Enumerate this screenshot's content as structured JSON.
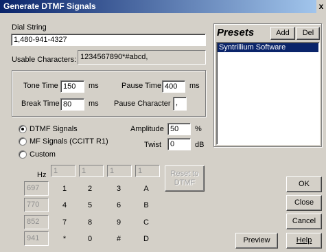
{
  "window": {
    "title": "Generate DTMF Signals",
    "close_glyph": "x"
  },
  "dial": {
    "label": "Dial String",
    "value": "1,480-941-4327",
    "usable_label": "Usable Characters:",
    "usable_value": "1234567890*#abcd,"
  },
  "timing": {
    "tone_time_label": "Tone Time",
    "tone_time_value": "150",
    "tone_time_unit": "ms",
    "break_time_label": "Break Time",
    "break_time_value": "80",
    "break_time_unit": "ms",
    "pause_time_label": "Pause Time",
    "pause_time_value": "400",
    "pause_time_unit": "ms",
    "pause_char_label": "Pause Character",
    "pause_char_value": ","
  },
  "signal_type": {
    "options": [
      {
        "label": "DTMF Signals",
        "selected": true
      },
      {
        "label": "MF Signals (CCITT R1)",
        "selected": false
      },
      {
        "label": "Custom",
        "selected": false
      }
    ],
    "amplitude_label": "Amplitude",
    "amplitude_value": "50",
    "amplitude_unit": "%",
    "twist_label": "Twist",
    "twist_value": "0",
    "twist_unit": "dB"
  },
  "keypad": {
    "hz_label": "Hz",
    "col_freqs": [
      "1",
      "1",
      "1",
      "1"
    ],
    "row_freqs": [
      "697",
      "770",
      "852",
      "941"
    ],
    "keys": [
      [
        "1",
        "2",
        "3",
        "A"
      ],
      [
        "4",
        "5",
        "6",
        "B"
      ],
      [
        "7",
        "8",
        "9",
        "C"
      ],
      [
        "*",
        "0",
        "#",
        "D"
      ]
    ],
    "reset_label_1": "Reset to",
    "reset_label_2": "DTMF"
  },
  "presets": {
    "title": "Presets",
    "add_label": "Add",
    "del_label": "Del",
    "items": [
      "Syntrillium Software"
    ]
  },
  "buttons": {
    "ok": "OK",
    "close": "Close",
    "cancel": "Cancel",
    "preview": "Preview",
    "help": "Help"
  }
}
